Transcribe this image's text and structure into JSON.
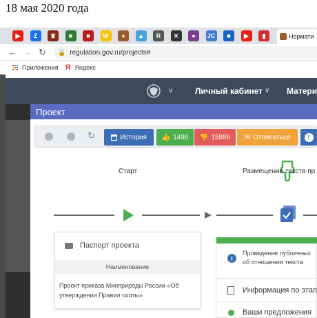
{
  "date_caption": "18 мая 2020 года",
  "browser": {
    "tabs": [
      {
        "icon": "youtube-icon",
        "color": "#e62117",
        "glyph": "▶"
      },
      {
        "icon": "z-icon",
        "color": "#1a73e8",
        "glyph": "Z"
      },
      {
        "icon": "emblem-icon",
        "color": "#8a2a1a",
        "glyph": "♛"
      },
      {
        "icon": "emblem-icon",
        "color": "#2e7d32",
        "glyph": "■"
      },
      {
        "icon": "emblem-icon",
        "color": "#b71c1c",
        "glyph": "■"
      },
      {
        "icon": "w-icon",
        "color": "#f5c400",
        "glyph": "W"
      },
      {
        "icon": "emblem-icon",
        "color": "#9c5b2f",
        "glyph": "♦"
      },
      {
        "icon": "landscape-icon",
        "color": "#4aa3df",
        "glyph": "▲"
      },
      {
        "icon": "r-icon",
        "color": "#555555",
        "glyph": "R"
      },
      {
        "icon": "cross-icon",
        "color": "#333333",
        "glyph": "✕"
      },
      {
        "icon": "circle-icon",
        "color": "#7a3e8e",
        "glyph": "●"
      },
      {
        "icon": "jc-icon",
        "color": "#3f7fd1",
        "glyph": "JC"
      },
      {
        "icon": "flag-icon",
        "color": "#1565c0",
        "glyph": "■"
      },
      {
        "icon": "youtube-icon",
        "color": "#e62117",
        "glyph": "▶"
      },
      {
        "icon": "book-icon",
        "color": "#d32f2f",
        "glyph": "▮"
      }
    ],
    "active_tab_title": "Нормати",
    "url": "regulation.gov.ru/projects#",
    "bookmarks": [
      {
        "icon": "apps-icon",
        "label": "Приложения"
      },
      {
        "icon": "yandex-icon",
        "label": "Яндекс"
      }
    ]
  },
  "site": {
    "nav": {
      "cabinet": "Личный кабинет",
      "materials": "Материа"
    },
    "page_title": "Проект",
    "toolbar": {
      "history": "История",
      "likes": "1498",
      "dislikes": "15886",
      "unsubscribe": "Отписаться",
      "colors": {
        "history": "#3b6eb4",
        "likes": "#4cae4c",
        "dislikes": "#e35b5b",
        "unsubscribe": "#f0a33a",
        "info": "#3b6eb4"
      }
    },
    "stages": {
      "start": "Старт",
      "placement": "Размещение текста пр"
    },
    "passport": {
      "header": "Паспорт проекта",
      "name_label": "Наименование",
      "name_value": "Проект приказа Минприроды России «Об утверждении Правил охоты»"
    },
    "info": {
      "notice": "Проведение публичных об отношении текста проект",
      "stage_info": "Информация по этапу",
      "proposals": "Ваши предложения"
    }
  }
}
